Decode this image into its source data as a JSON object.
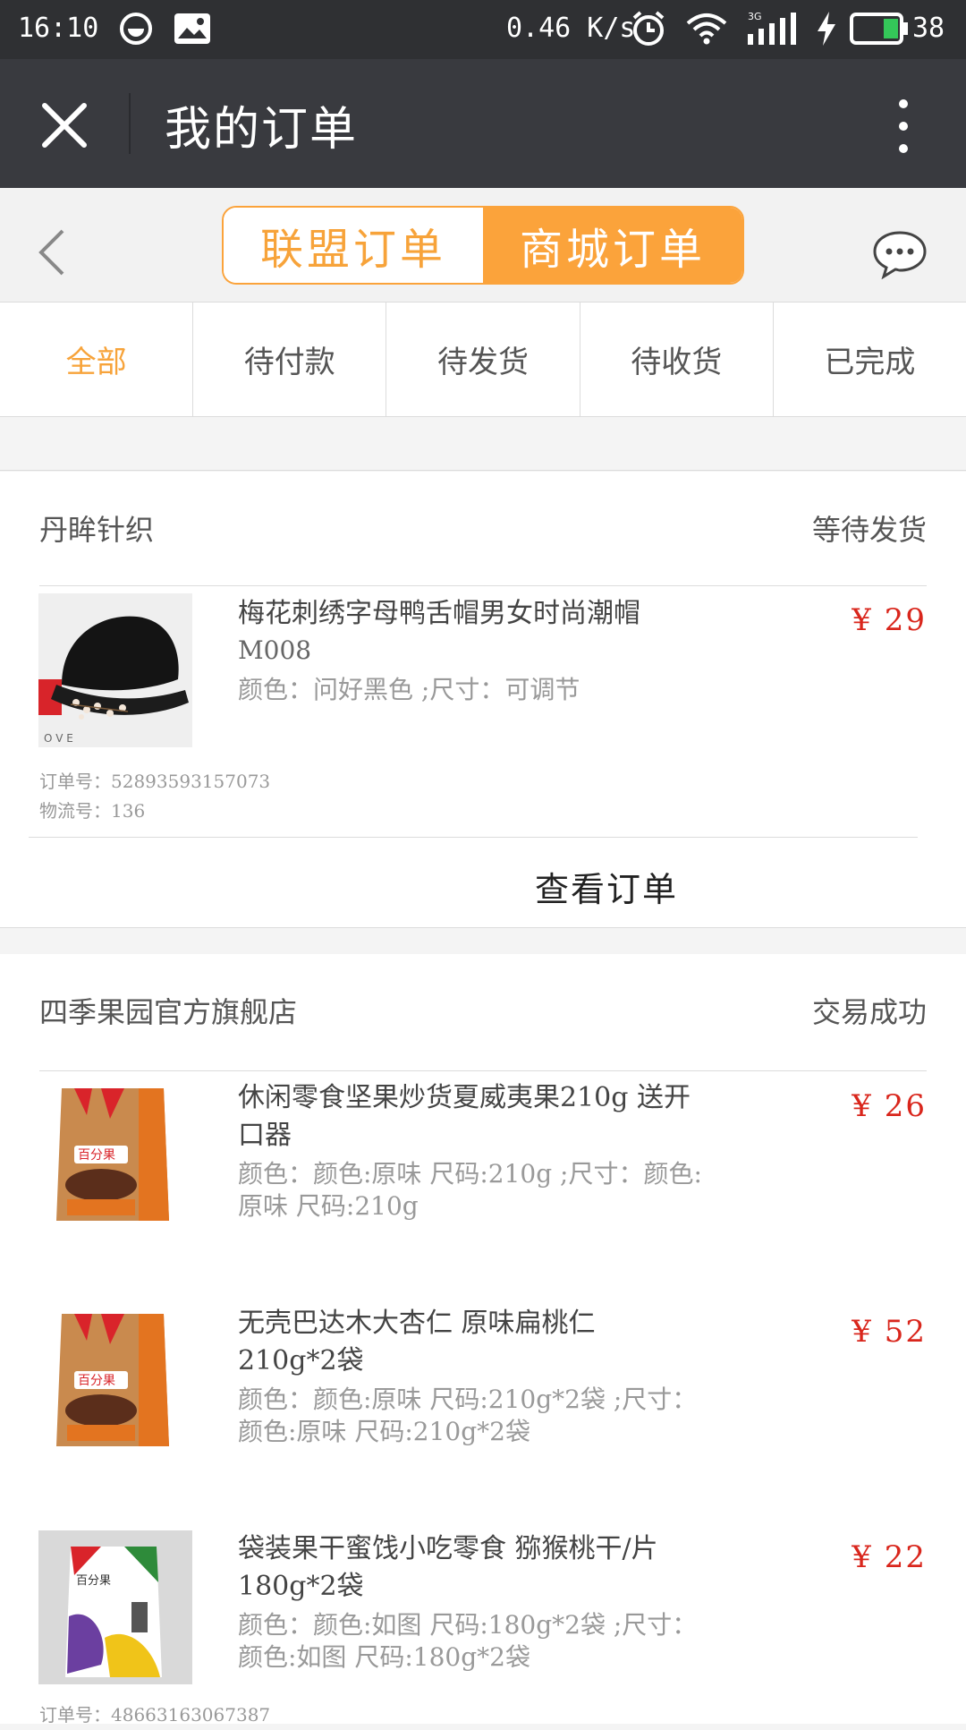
{
  "status_bar": {
    "time": "16:10",
    "speed": "0.46 K/s",
    "battery": "38",
    "icons": [
      "face-icon",
      "image-icon",
      "alarm-icon",
      "wifi-icon",
      "signal-3g-icon",
      "charging-icon",
      "battery-icon"
    ]
  },
  "title_bar": {
    "title": "我的订单",
    "close_icon": "close-icon",
    "more_icon": "more-vertical-icon"
  },
  "segment": {
    "left_label": "联盟订单",
    "right_label": "商城订单",
    "active": "right",
    "accent_color": "#fba33b"
  },
  "tabs": [
    {
      "label": "全部",
      "active": true
    },
    {
      "label": "待付款"
    },
    {
      "label": "待发货"
    },
    {
      "label": "待收货"
    },
    {
      "label": "已完成"
    }
  ],
  "orders": [
    {
      "shop": "丹眸针织",
      "status": "等待发货",
      "items": [
        {
          "name": "梅花刺绣字母鸭舌帽男女时尚潮帽",
          "code": "M008",
          "spec": "颜色：问好黑色 ;尺寸：可调节",
          "price": "¥ 29"
        }
      ],
      "order_no_line": "订单号：52893593157073",
      "logistics_line": "物流号：136",
      "view_label": "查看订单"
    },
    {
      "shop": "四季果园官方旗舰店",
      "status": "交易成功",
      "items": [
        {
          "name": "休闲零食坚果炒货夏威夷果210g 送开口器",
          "spec": "颜色：颜色:原味 尺码:210g ;尺寸：颜色:原味 尺码:210g",
          "price": "¥ 26"
        },
        {
          "name": "无壳巴达木大杏仁 原味扁桃仁210g*2袋",
          "spec": "颜色：颜色:原味 尺码:210g*2袋 ;尺寸：颜色:原味 尺码:210g*2袋",
          "price": "¥ 52"
        },
        {
          "name": "袋装果干蜜饯小吃零食 猕猴桃干/片180g*2袋",
          "spec": "颜色：颜色:如图 尺码:180g*2袋 ;尺寸：颜色:如图 尺码:180g*2袋",
          "price": "¥ 22"
        }
      ],
      "order_no_line": "订单号：48663163067387"
    }
  ]
}
